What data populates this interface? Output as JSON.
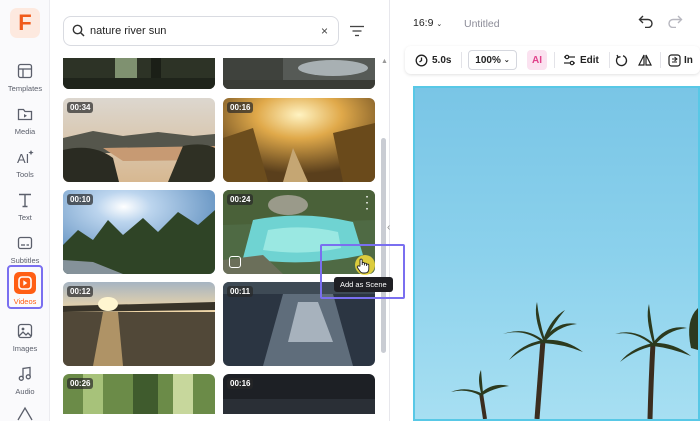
{
  "rail": {
    "logo_letter": "F",
    "items": [
      {
        "label": "Templates",
        "icon": "templates-icon"
      },
      {
        "label": "Media",
        "icon": "media-icon"
      },
      {
        "label": "Tools",
        "icon": "ai-tools-icon"
      },
      {
        "label": "Text",
        "icon": "text-icon"
      },
      {
        "label": "Subtitles",
        "icon": "subtitles-icon"
      },
      {
        "label": "Videos",
        "icon": "videos-icon",
        "active": true
      },
      {
        "label": "Images",
        "icon": "images-icon"
      },
      {
        "label": "Audio",
        "icon": "audio-icon"
      }
    ]
  },
  "search": {
    "query": "nature river sun",
    "clear_symbol": "×"
  },
  "videos": [
    {
      "duration": "00:34"
    },
    {
      "duration": "00:16"
    },
    {
      "duration": "00:10"
    },
    {
      "duration": "00:24"
    },
    {
      "duration": "00:12"
    },
    {
      "duration": "00:11"
    },
    {
      "duration": "00:26"
    },
    {
      "duration": "00:16"
    }
  ],
  "tooltip": "Add as Scene",
  "editor": {
    "aspect_ratio": "16:9",
    "document_name": "Untitled",
    "toolbar": {
      "duration": "5.0s",
      "zoom": "100%",
      "ai_label": "AI",
      "edit_label": "Edit",
      "truncated_label": "In"
    }
  },
  "colors": {
    "accent": "#ff5e14",
    "highlight": "#7a6ff0",
    "canvas_border": "#58c8e6"
  }
}
